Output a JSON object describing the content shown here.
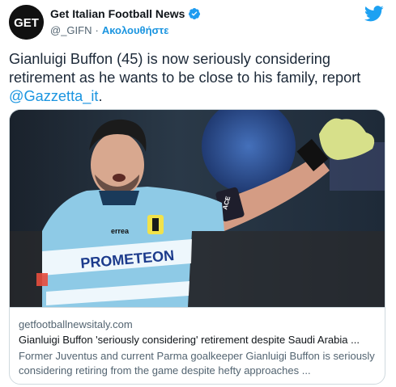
{
  "author": {
    "display_name": "Get Italian Football News",
    "handle": "@_GIFN",
    "separator": "·",
    "follow_label": "Ακολουθήστε",
    "avatar_text": "GET",
    "verified": true
  },
  "tweet": {
    "text_before": "Gianluigi Buffon (45) is now seriously considering retirement as he wants to be close to his family, report ",
    "mention": "@Gazzetta_it",
    "text_after": "."
  },
  "card": {
    "image_texts": {
      "sponsor": "PROMETEON",
      "captain_band": "ACE",
      "kit_brand": "errea"
    },
    "domain": "getfootballnewsitaly.com",
    "title": "Gianluigi Buffon 'seriously considering' retirement despite Saudi Arabia ...",
    "description": "Former Juventus and current Parma goalkeeper Gianluigi Buffon is seriously considering retiring from the game despite hefty approaches ..."
  },
  "colors": {
    "link": "#1b95e0",
    "verified": "#1d9bf0",
    "jersey": "#8ecae6"
  }
}
